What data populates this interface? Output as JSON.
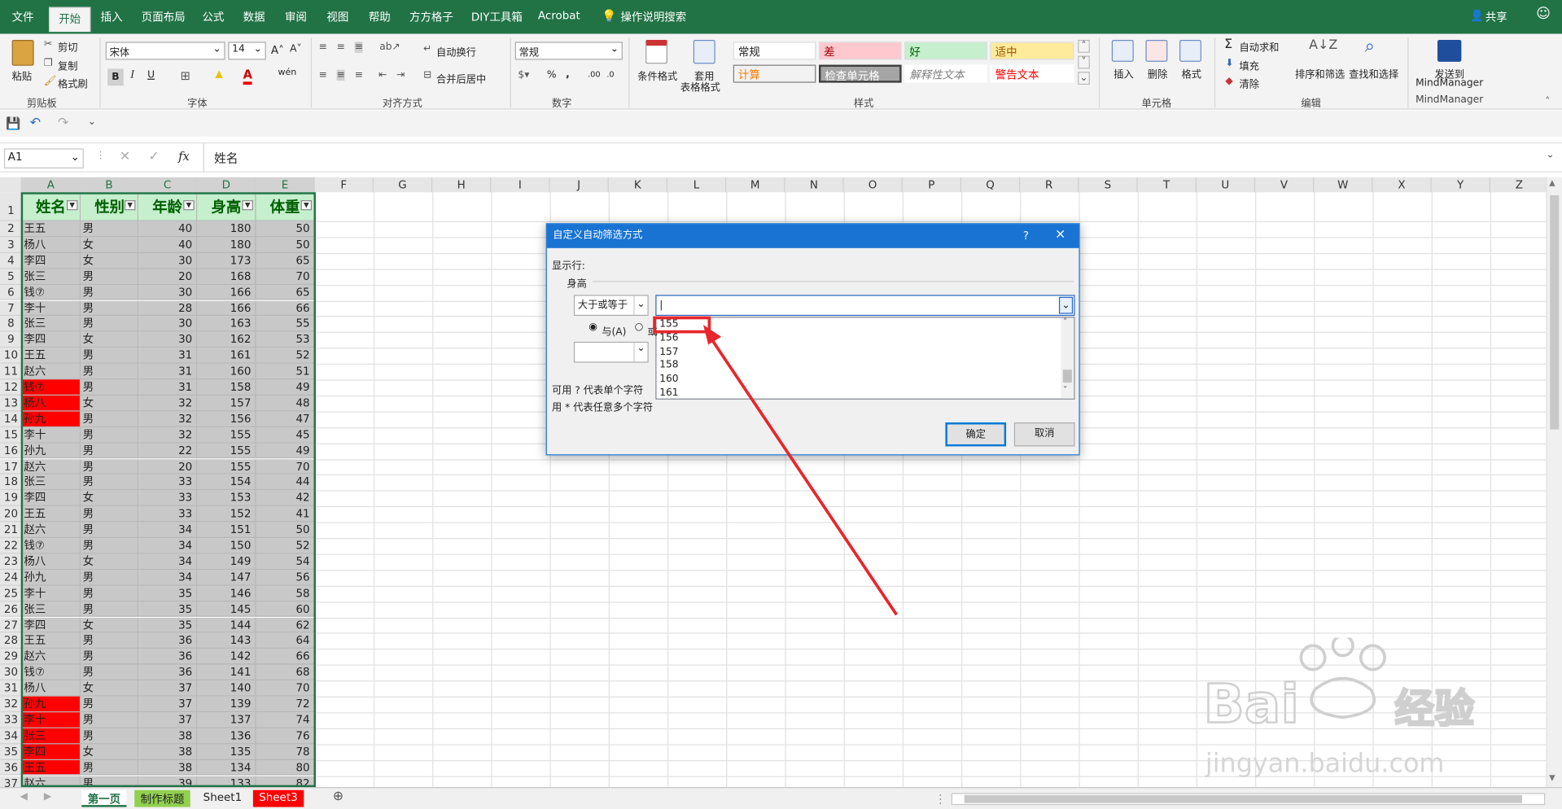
{
  "ribbon_tabs": [
    "文件",
    "开始",
    "插入",
    "页面布局",
    "公式",
    "数据",
    "审阅",
    "视图",
    "帮助",
    "方方格子",
    "DIY工具箱",
    "Acrobat",
    "操作说明搜索"
  ],
  "share_label": "共享",
  "clipboard": {
    "paste": "粘贴",
    "cut": "剪切",
    "copy": "复制",
    "format_painter": "格式刷",
    "group": "剪贴板"
  },
  "font": {
    "name": "宋体",
    "size": "14",
    "bold": "B",
    "italic": "I",
    "underline": "U",
    "group": "字体"
  },
  "alignment": {
    "wrap": "自动换行",
    "merge": "合并后居中",
    "group": "对齐方式"
  },
  "number": {
    "format": "常规",
    "group": "数字"
  },
  "styles": {
    "conditional": "条件格式",
    "table_format_1": "套用",
    "table_format_2": "表格格式",
    "normal": "常规",
    "bad": "差",
    "good": "好",
    "neutral": "适中",
    "calc": "计算",
    "check": "检查单元格",
    "explain": "解释性文本",
    "warning": "警告文本",
    "group": "样式"
  },
  "cells": {
    "insert": "插入",
    "delete": "删除",
    "format": "格式",
    "group": "单元格"
  },
  "editing": {
    "autosum": "自动求和",
    "fill": "填充",
    "clear": "清除",
    "sort": "排序和筛选",
    "find": "查找和选择",
    "group": "编辑"
  },
  "mindmanager": {
    "send_1": "发送到",
    "send_2": "MindManager",
    "group": "MindManager"
  },
  "namebox": "A1",
  "formula": "姓名",
  "columns": [
    "A",
    "B",
    "C",
    "D",
    "E",
    "F",
    "G",
    "H",
    "I",
    "J",
    "K",
    "L",
    "M",
    "N",
    "O",
    "P",
    "Q",
    "R",
    "S",
    "T",
    "U",
    "V",
    "W",
    "X",
    "Y",
    "Z"
  ],
  "headers": [
    "姓名",
    "性别",
    "年龄",
    "身高",
    "体重"
  ],
  "rows": [
    [
      "王五",
      "男",
      "40",
      "180",
      "50"
    ],
    [
      "杨八",
      "女",
      "40",
      "180",
      "50"
    ],
    [
      "李四",
      "女",
      "30",
      "173",
      "65"
    ],
    [
      "张三",
      "男",
      "20",
      "168",
      "70"
    ],
    [
      "钱⑦",
      "男",
      "30",
      "166",
      "65"
    ],
    [
      "李十",
      "男",
      "28",
      "166",
      "66"
    ],
    [
      "张三",
      "男",
      "30",
      "163",
      "55"
    ],
    [
      "李四",
      "女",
      "30",
      "162",
      "53"
    ],
    [
      "王五",
      "男",
      "31",
      "161",
      "52"
    ],
    [
      "赵六",
      "男",
      "31",
      "160",
      "51"
    ],
    [
      "钱⑦",
      "男",
      "31",
      "158",
      "49"
    ],
    [
      "杨八",
      "女",
      "32",
      "157",
      "48"
    ],
    [
      "孙九",
      "男",
      "32",
      "156",
      "47"
    ],
    [
      "李十",
      "男",
      "32",
      "155",
      "45"
    ],
    [
      "孙九",
      "男",
      "22",
      "155",
      "49"
    ],
    [
      "赵六",
      "男",
      "20",
      "155",
      "70"
    ],
    [
      "张三",
      "男",
      "33",
      "154",
      "44"
    ],
    [
      "李四",
      "女",
      "33",
      "153",
      "42"
    ],
    [
      "王五",
      "男",
      "33",
      "152",
      "41"
    ],
    [
      "赵六",
      "男",
      "34",
      "151",
      "50"
    ],
    [
      "钱⑦",
      "男",
      "34",
      "150",
      "52"
    ],
    [
      "杨八",
      "女",
      "34",
      "149",
      "54"
    ],
    [
      "孙九",
      "男",
      "34",
      "147",
      "56"
    ],
    [
      "李十",
      "男",
      "35",
      "146",
      "58"
    ],
    [
      "张三",
      "男",
      "35",
      "145",
      "60"
    ],
    [
      "李四",
      "女",
      "35",
      "144",
      "62"
    ],
    [
      "王五",
      "男",
      "36",
      "143",
      "64"
    ],
    [
      "赵六",
      "男",
      "36",
      "142",
      "66"
    ],
    [
      "钱⑦",
      "男",
      "36",
      "141",
      "68"
    ],
    [
      "杨八",
      "女",
      "37",
      "140",
      "70"
    ],
    [
      "孙九",
      "男",
      "37",
      "139",
      "72"
    ],
    [
      "李十",
      "男",
      "37",
      "137",
      "74"
    ],
    [
      "张三",
      "男",
      "38",
      "136",
      "76"
    ],
    [
      "李四",
      "女",
      "38",
      "135",
      "78"
    ],
    [
      "王五",
      "男",
      "38",
      "134",
      "80"
    ],
    [
      "赵六",
      "男",
      "39",
      "133",
      "82"
    ]
  ],
  "red_rows": [
    12,
    13,
    14,
    32,
    33,
    34,
    35,
    36
  ],
  "sheet_tabs": [
    "第一页",
    "制作标题",
    "Sheet1",
    "Sheet3"
  ],
  "dialog": {
    "title": "自定义自动筛选方式",
    "help": "?",
    "close": "×",
    "show_rows": "显示行:",
    "field": "身高",
    "operator": "大于或等于",
    "and_label": "与(A)",
    "or_label": "或",
    "hint1": "可用 ? 代表单个字符",
    "hint2": "用 * 代表任意多个字符",
    "ok": "确定",
    "cancel": "取消",
    "options": [
      "155",
      "156",
      "157",
      "158",
      "160",
      "161"
    ]
  },
  "colors": {
    "excel_green": "#217346",
    "dialog_blue": "#1873d3",
    "highlight_red": "#ff0000",
    "header_green_fill": "#c6efce"
  },
  "watermark": "Bai du 经验 jingyan.baidu.com"
}
